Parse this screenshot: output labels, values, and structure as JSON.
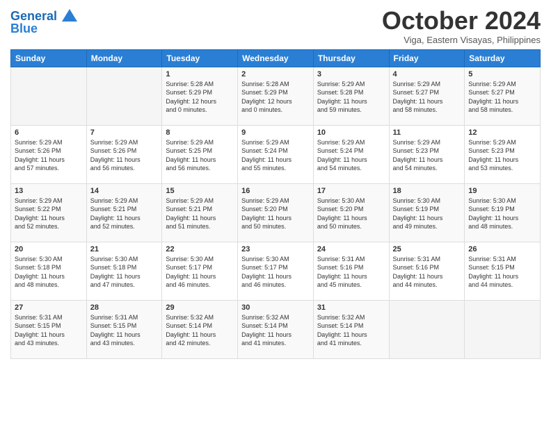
{
  "header": {
    "logo_line1": "General",
    "logo_line2": "Blue",
    "month": "October 2024",
    "location": "Viga, Eastern Visayas, Philippines"
  },
  "weekdays": [
    "Sunday",
    "Monday",
    "Tuesday",
    "Wednesday",
    "Thursday",
    "Friday",
    "Saturday"
  ],
  "weeks": [
    [
      {
        "day": "",
        "info": ""
      },
      {
        "day": "",
        "info": ""
      },
      {
        "day": "1",
        "info": "Sunrise: 5:28 AM\nSunset: 5:29 PM\nDaylight: 12 hours\nand 0 minutes."
      },
      {
        "day": "2",
        "info": "Sunrise: 5:28 AM\nSunset: 5:29 PM\nDaylight: 12 hours\nand 0 minutes."
      },
      {
        "day": "3",
        "info": "Sunrise: 5:29 AM\nSunset: 5:28 PM\nDaylight: 11 hours\nand 59 minutes."
      },
      {
        "day": "4",
        "info": "Sunrise: 5:29 AM\nSunset: 5:27 PM\nDaylight: 11 hours\nand 58 minutes."
      },
      {
        "day": "5",
        "info": "Sunrise: 5:29 AM\nSunset: 5:27 PM\nDaylight: 11 hours\nand 58 minutes."
      }
    ],
    [
      {
        "day": "6",
        "info": "Sunrise: 5:29 AM\nSunset: 5:26 PM\nDaylight: 11 hours\nand 57 minutes."
      },
      {
        "day": "7",
        "info": "Sunrise: 5:29 AM\nSunset: 5:26 PM\nDaylight: 11 hours\nand 56 minutes."
      },
      {
        "day": "8",
        "info": "Sunrise: 5:29 AM\nSunset: 5:25 PM\nDaylight: 11 hours\nand 56 minutes."
      },
      {
        "day": "9",
        "info": "Sunrise: 5:29 AM\nSunset: 5:24 PM\nDaylight: 11 hours\nand 55 minutes."
      },
      {
        "day": "10",
        "info": "Sunrise: 5:29 AM\nSunset: 5:24 PM\nDaylight: 11 hours\nand 54 minutes."
      },
      {
        "day": "11",
        "info": "Sunrise: 5:29 AM\nSunset: 5:23 PM\nDaylight: 11 hours\nand 54 minutes."
      },
      {
        "day": "12",
        "info": "Sunrise: 5:29 AM\nSunset: 5:23 PM\nDaylight: 11 hours\nand 53 minutes."
      }
    ],
    [
      {
        "day": "13",
        "info": "Sunrise: 5:29 AM\nSunset: 5:22 PM\nDaylight: 11 hours\nand 52 minutes."
      },
      {
        "day": "14",
        "info": "Sunrise: 5:29 AM\nSunset: 5:21 PM\nDaylight: 11 hours\nand 52 minutes."
      },
      {
        "day": "15",
        "info": "Sunrise: 5:29 AM\nSunset: 5:21 PM\nDaylight: 11 hours\nand 51 minutes."
      },
      {
        "day": "16",
        "info": "Sunrise: 5:29 AM\nSunset: 5:20 PM\nDaylight: 11 hours\nand 50 minutes."
      },
      {
        "day": "17",
        "info": "Sunrise: 5:30 AM\nSunset: 5:20 PM\nDaylight: 11 hours\nand 50 minutes."
      },
      {
        "day": "18",
        "info": "Sunrise: 5:30 AM\nSunset: 5:19 PM\nDaylight: 11 hours\nand 49 minutes."
      },
      {
        "day": "19",
        "info": "Sunrise: 5:30 AM\nSunset: 5:19 PM\nDaylight: 11 hours\nand 48 minutes."
      }
    ],
    [
      {
        "day": "20",
        "info": "Sunrise: 5:30 AM\nSunset: 5:18 PM\nDaylight: 11 hours\nand 48 minutes."
      },
      {
        "day": "21",
        "info": "Sunrise: 5:30 AM\nSunset: 5:18 PM\nDaylight: 11 hours\nand 47 minutes."
      },
      {
        "day": "22",
        "info": "Sunrise: 5:30 AM\nSunset: 5:17 PM\nDaylight: 11 hours\nand 46 minutes."
      },
      {
        "day": "23",
        "info": "Sunrise: 5:30 AM\nSunset: 5:17 PM\nDaylight: 11 hours\nand 46 minutes."
      },
      {
        "day": "24",
        "info": "Sunrise: 5:31 AM\nSunset: 5:16 PM\nDaylight: 11 hours\nand 45 minutes."
      },
      {
        "day": "25",
        "info": "Sunrise: 5:31 AM\nSunset: 5:16 PM\nDaylight: 11 hours\nand 44 minutes."
      },
      {
        "day": "26",
        "info": "Sunrise: 5:31 AM\nSunset: 5:15 PM\nDaylight: 11 hours\nand 44 minutes."
      }
    ],
    [
      {
        "day": "27",
        "info": "Sunrise: 5:31 AM\nSunset: 5:15 PM\nDaylight: 11 hours\nand 43 minutes."
      },
      {
        "day": "28",
        "info": "Sunrise: 5:31 AM\nSunset: 5:15 PM\nDaylight: 11 hours\nand 43 minutes."
      },
      {
        "day": "29",
        "info": "Sunrise: 5:32 AM\nSunset: 5:14 PM\nDaylight: 11 hours\nand 42 minutes."
      },
      {
        "day": "30",
        "info": "Sunrise: 5:32 AM\nSunset: 5:14 PM\nDaylight: 11 hours\nand 41 minutes."
      },
      {
        "day": "31",
        "info": "Sunrise: 5:32 AM\nSunset: 5:14 PM\nDaylight: 11 hours\nand 41 minutes."
      },
      {
        "day": "",
        "info": ""
      },
      {
        "day": "",
        "info": ""
      }
    ]
  ]
}
